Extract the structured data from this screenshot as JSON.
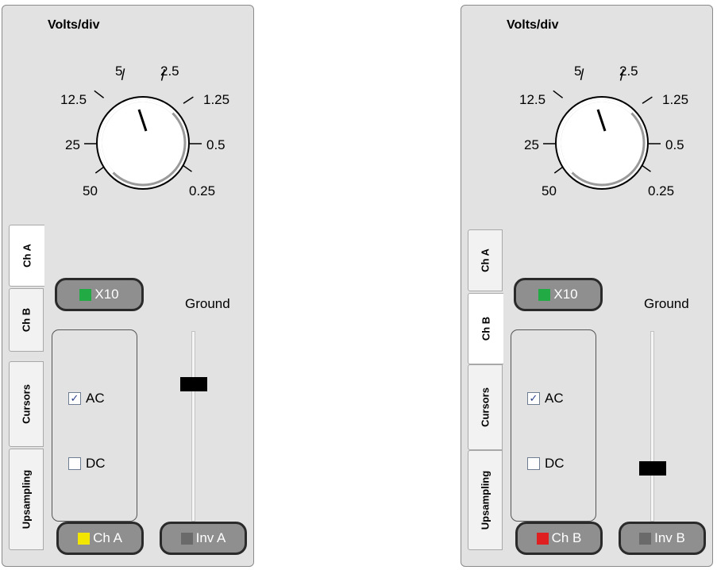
{
  "panels": [
    {
      "title": "Volts/div",
      "dial": {
        "labels": [
          "5",
          "2.5",
          "12.5",
          "1.25",
          "25",
          "0.5",
          "50",
          "0.25"
        ],
        "selected": "5"
      },
      "tabs": [
        "Ch A",
        "Ch B",
        "Cursors",
        "Upsampling"
      ],
      "active_tab": "Ch A",
      "x10": {
        "label": "X10",
        "led": "#22aa44"
      },
      "coupling": {
        "ac": {
          "label": "AC",
          "checked": true,
          "mark": "✓"
        },
        "dc": {
          "label": "DC",
          "checked": false
        }
      },
      "ground": {
        "label": "Ground",
        "level": 0.72
      },
      "channel": {
        "label": "Ch A",
        "led": "#f2e600"
      },
      "invert": {
        "label": "Inv A",
        "led": "#6a6a6a"
      }
    },
    {
      "title": "Volts/div",
      "dial": {
        "labels": [
          "5",
          "2.5",
          "12.5",
          "1.25",
          "25",
          "0.5",
          "50",
          "0.25"
        ],
        "selected": "5"
      },
      "tabs": [
        "Ch A",
        "Ch B",
        "Cursors",
        "Upsampling"
      ],
      "active_tab": "Ch B",
      "x10": {
        "label": "X10",
        "led": "#22aa44"
      },
      "coupling": {
        "ac": {
          "label": "AC",
          "checked": true,
          "mark": "✓"
        },
        "dc": {
          "label": "DC",
          "checked": false
        }
      },
      "ground": {
        "label": "Ground",
        "level": 0.28
      },
      "channel": {
        "label": "Ch B",
        "led": "#e02020"
      },
      "invert": {
        "label": "Inv B",
        "led": "#6a6a6a"
      }
    }
  ]
}
